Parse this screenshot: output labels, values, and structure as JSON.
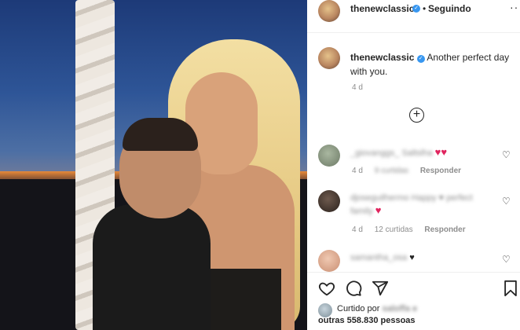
{
  "post": {
    "username": "thenewclassic",
    "follow_status": "Seguindo",
    "more_icon": "ellipsis-icon"
  },
  "caption": {
    "username": "thenewclassic",
    "text": "Another perfect day with you.",
    "time": "4 d"
  },
  "comments": [
    {
      "text": "_giovanggs_ Saltslha",
      "emoji": "♥♥",
      "time": "4 d",
      "likes": "9 curtidas",
      "reply": "Responder"
    },
    {
      "text": "djoseguilhermo Happy ♥ perfect family",
      "emoji": "♥",
      "time": "4 d",
      "likes": "12 curtidas",
      "reply": "Responder"
    },
    {
      "text": "samantha_osa",
      "emoji": "♥"
    }
  ],
  "likes": {
    "prefix": "Curtido por",
    "liker": "saloffa e",
    "others": "outras 558.830 pessoas"
  },
  "icons": {
    "heart": "heart-icon",
    "comment": "comment-icon",
    "share": "share-icon",
    "save": "bookmark-icon",
    "load_more": "plus-circle-icon"
  },
  "colors": {
    "verified": "#3897f0",
    "heart_red": "#e0245e",
    "secondary_text": "#8e8e8e"
  }
}
